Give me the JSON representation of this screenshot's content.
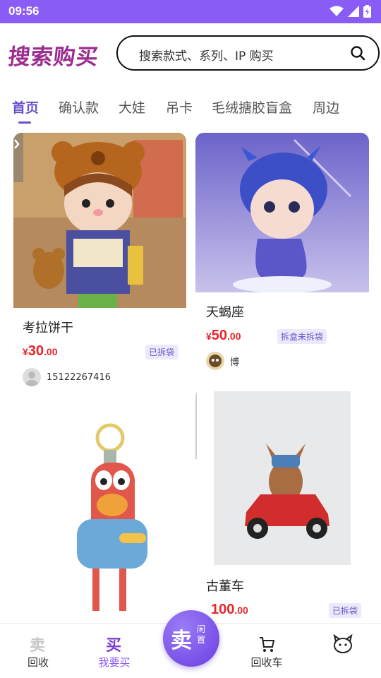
{
  "status_bar": {
    "time": "09:56"
  },
  "header": {
    "logo_text": "搜索购买",
    "search_placeholder": "搜索款式、系列、IP 购买"
  },
  "tabs": [
    {
      "label": "首页",
      "active": true
    },
    {
      "label": "确认款"
    },
    {
      "label": "大娃"
    },
    {
      "label": "吊卡"
    },
    {
      "label": "毛绒搪胶盲盒"
    },
    {
      "label": "周边"
    }
  ],
  "products": [
    {
      "title": "考拉饼干",
      "currency": "¥",
      "price_int": "30",
      "price_dec": ".00",
      "tag": "已拆袋",
      "seller": "15122267416"
    },
    {
      "title": "天蝎座",
      "currency": "¥",
      "price_int": "50",
      "price_dec": ".00",
      "tag": "拆盒未拆袋",
      "seller": "博"
    },
    {
      "title": "古董车",
      "currency": "",
      "price_int": "100",
      "price_dec": ".00",
      "tag": "已拆袋"
    }
  ],
  "bottom_nav": {
    "items": [
      {
        "label": "回收",
        "icon": "recycle-icon"
      },
      {
        "label": "我要买",
        "icon": "buy-icon",
        "active": true
      },
      {
        "label": "回收车",
        "icon": "cart-icon"
      },
      {
        "label": "",
        "icon": "profile-icon"
      }
    ],
    "sell_button": {
      "big": "卖",
      "small": "闲置"
    }
  },
  "colors": {
    "brand": "#8a5cf6",
    "active_tab": "#6b4fd0",
    "price": "#e8262b",
    "logo": "#9b2d8f"
  }
}
